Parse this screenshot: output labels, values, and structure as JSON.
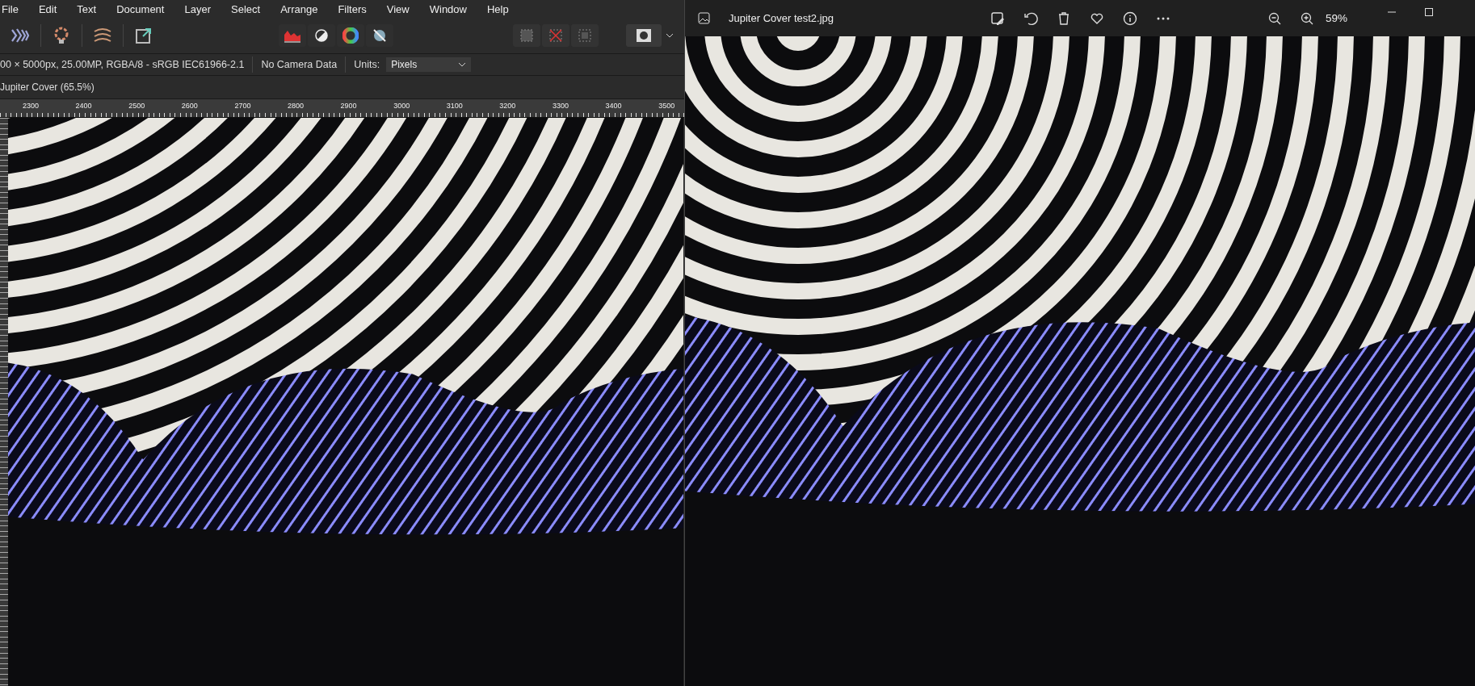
{
  "photo_editor": {
    "menu": [
      "File",
      "Edit",
      "Text",
      "Document",
      "Layer",
      "Select",
      "Arrange",
      "Filters",
      "View",
      "Window",
      "Help"
    ],
    "info_bar": {
      "document_info": "00 × 5000px, 25.00MP, RGBA/8 - sRGB IEC61966-2.1",
      "camera_info": "No Camera Data",
      "units_label": "Units:",
      "units_value": "Pixels"
    },
    "document_tab": "Jupiter Cover (65.5%)",
    "ruler_labels": [
      "2300",
      "2400",
      "2500",
      "2600",
      "2700",
      "2800",
      "2900",
      "3000",
      "3100",
      "3200",
      "3300",
      "3400",
      "3500"
    ]
  },
  "photo_viewer": {
    "title": "Jupiter Cover test2.jpg",
    "zoom": "59%"
  }
}
